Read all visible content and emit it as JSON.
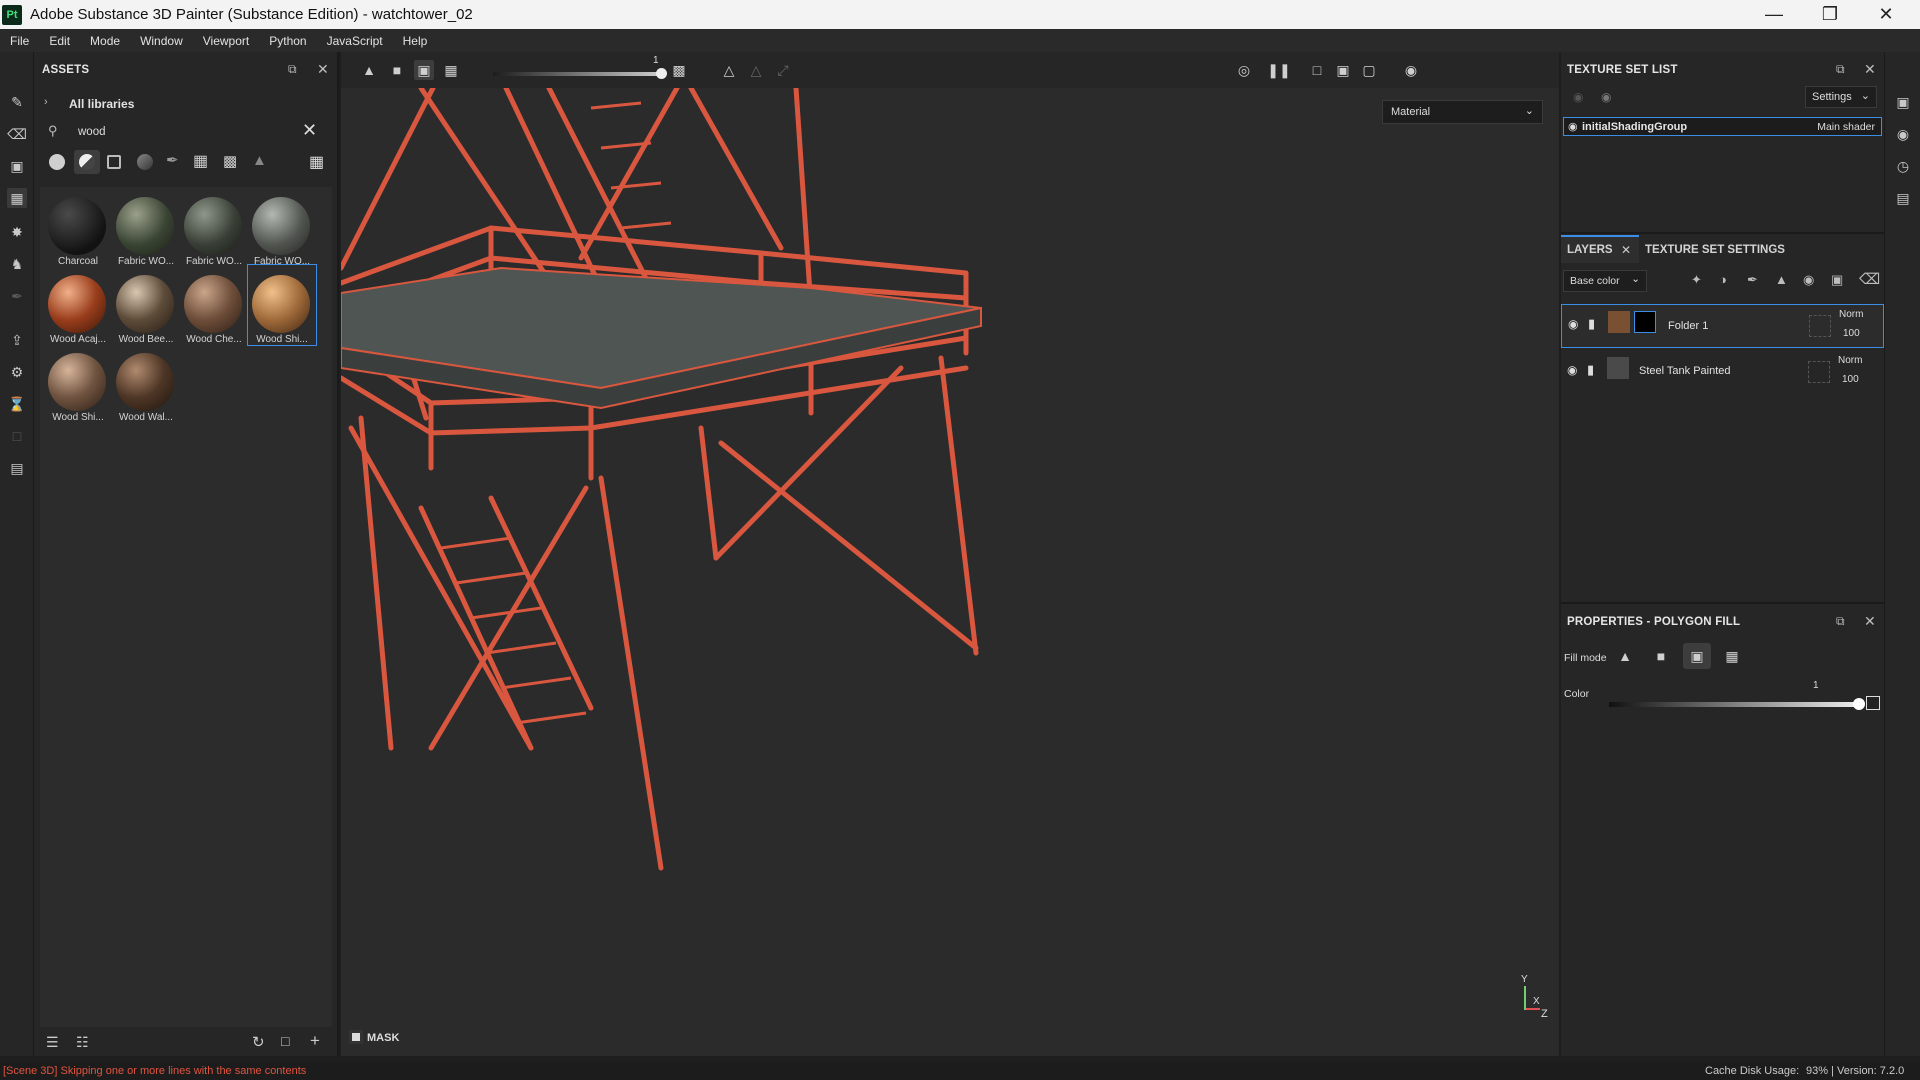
{
  "window": {
    "app_badge": "Pt",
    "title": "Adobe Substance 3D Painter (Substance Edition) - watchtower_02"
  },
  "menu": [
    "File",
    "Edit",
    "Mode",
    "Window",
    "Viewport",
    "Python",
    "JavaScript",
    "Help"
  ],
  "assets": {
    "title": "ASSETS",
    "library": "All libraries",
    "search_value": "wood",
    "items": [
      {
        "label": "Charcoal",
        "color": "#1f1f1f"
      },
      {
        "label": "Fabric WO...",
        "color": "#4f5a45"
      },
      {
        "label": "Fabric WO...",
        "color": "#4a4f46"
      },
      {
        "label": "Fabric WO...",
        "color": "#5b5e5a"
      },
      {
        "label": "Wood Acaj...",
        "color": "#8a3a1c"
      },
      {
        "label": "Wood Bee...",
        "color": "#6b5a48"
      },
      {
        "label": "Wood Che...",
        "color": "#7a5a45"
      },
      {
        "label": "Wood Shi...",
        "color": "#a06a3a"
      },
      {
        "label": "Wood Shi...",
        "color": "#7a5a45"
      },
      {
        "label": "Wood Wal...",
        "color": "#5a3f2c"
      }
    ],
    "selected_index": 7
  },
  "viewport": {
    "slider_value": "1",
    "material_mode": "Material",
    "mask_label": "MASK",
    "axis_y": "Y",
    "axis_x": "X",
    "axis_z": "Z"
  },
  "texture_set_list": {
    "title": "TEXTURE SET LIST",
    "settings_label": "Settings",
    "set_name": "initialShadingGroup",
    "shader": "Main shader"
  },
  "layers": {
    "tab_layers": "LAYERS",
    "tab_texture_settings": "TEXTURE SET SETTINGS",
    "channel": "Base color",
    "rows": [
      {
        "name": "Folder 1",
        "blend": "Norm",
        "opacity": "100"
      },
      {
        "name": "Steel Tank Painted",
        "blend": "Norm",
        "opacity": "100"
      }
    ]
  },
  "properties": {
    "title": "PROPERTIES - POLYGON FILL",
    "fill_mode_label": "Fill mode",
    "color_label": "Color",
    "color_slider_value": "1"
  },
  "status": {
    "message": "[Scene 3D] Skipping one or more lines with the same contents",
    "cache_label": "Cache Disk Usage:",
    "cache_value": "93% | Version: 7.2.0"
  },
  "colors": {
    "accent": "#3a8ee6",
    "wireframe": "#e0553f",
    "status_warning": "#e0553f"
  }
}
